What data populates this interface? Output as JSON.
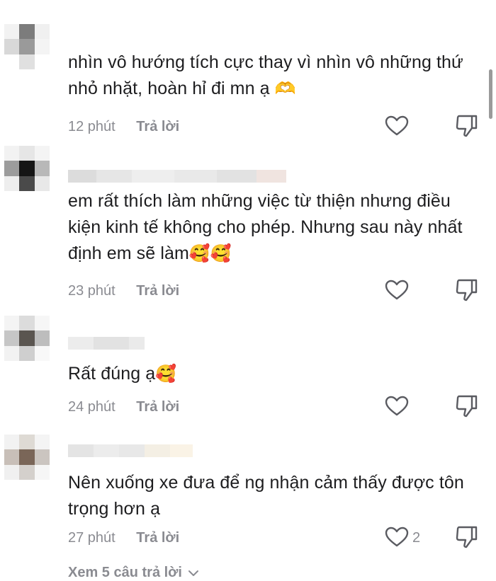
{
  "comments": [
    {
      "text": "nhìn vô hướng tích cực thay vì nhìn vô những thứ nhỏ nhặt, hoàn hỉ đi mn ạ",
      "emoji": "🫶",
      "time": "12 phút",
      "reply": "Trả lời",
      "likes": ""
    },
    {
      "text": "em rất thích làm những việc từ thiện nhưng điều kiện kinh tế không cho phép. Nhưng sau này nhất định em sẽ làm",
      "emoji": "🥰🥰",
      "time": "23 phút",
      "reply": "Trả lời",
      "likes": ""
    },
    {
      "text": "Rất đúng ạ",
      "emoji": "🥰",
      "time": "24 phút",
      "reply": "Trả lời",
      "likes": ""
    },
    {
      "text": "Nên xuống xe đưa để ng nhận cảm thấy được tôn trọng hơn ạ",
      "emoji": "",
      "time": "27 phút",
      "reply": "Trả lời",
      "likes": "2"
    }
  ],
  "view_replies": "Xem 5 câu trả lời",
  "icons": {
    "like": "heart-outline-icon",
    "dislike": "thumbs-down-outline-icon",
    "expand": "chevron-down-icon"
  },
  "colors": {
    "text": "#1d1d1f",
    "meta": "#8a8b91",
    "background": "#ffffff"
  }
}
